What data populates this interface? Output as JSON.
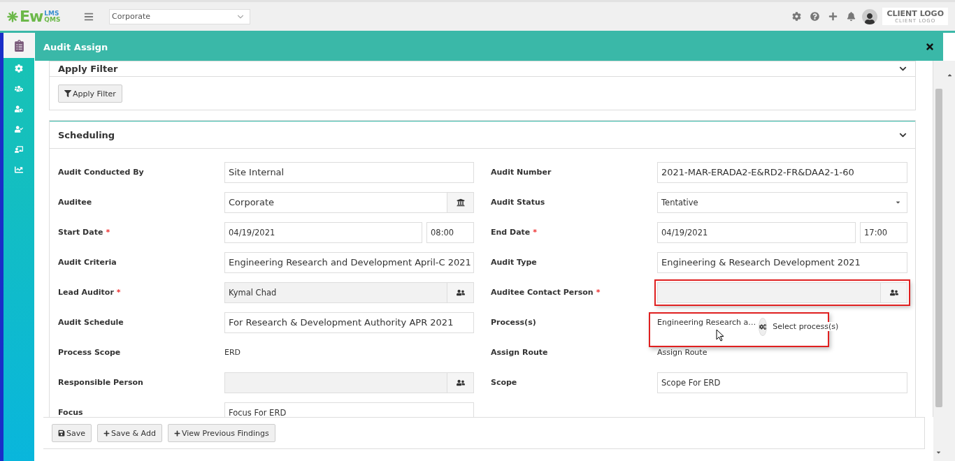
{
  "header": {
    "logo": {
      "name": "Ew",
      "sup": "LMS",
      "sub": "QMS"
    },
    "site_select": {
      "value": "Corporate"
    },
    "client_logo": {
      "title": "CLIENT LOGO",
      "subtitle": "CLIENT LOGO"
    }
  },
  "sidebar": {
    "items": [
      {
        "kind": "document",
        "selected": true
      },
      {
        "kind": "gear",
        "selected": false
      },
      {
        "kind": "users-gear",
        "selected": false
      },
      {
        "kind": "user-shield",
        "selected": false
      },
      {
        "kind": "user-check",
        "selected": false
      },
      {
        "kind": "presenter",
        "selected": false
      },
      {
        "kind": "chart",
        "selected": false
      }
    ]
  },
  "modal": {
    "title": "Audit Assign"
  },
  "filter_section": {
    "title": "Apply Filter",
    "button": "Apply Filter"
  },
  "scheduling": {
    "title": "Scheduling",
    "rows": [
      {
        "left": {
          "label": "Audit Conducted By",
          "kind": "text",
          "value": "Site Internal"
        },
        "right": {
          "label": "Audit Number",
          "kind": "text",
          "value": "2021-MAR-ERADA2-E&RD2-FR&DAA2-1-60"
        }
      },
      {
        "left": {
          "label": "Auditee",
          "kind": "bank-lookup",
          "readonly": false,
          "value": "Corporate"
        },
        "right": {
          "label": "Audit Status",
          "kind": "select",
          "value": "Tentative"
        }
      },
      {
        "left": {
          "label": "Start Date",
          "required_mark": "*",
          "kind": "datetime",
          "value": "04/19/2021",
          "time": "08:00"
        },
        "right": {
          "label": "End Date",
          "required_mark": "*",
          "kind": "datetime",
          "value": "04/19/2021",
          "time": "17:00"
        }
      },
      {
        "left": {
          "label": "Audit Criteria",
          "kind": "text",
          "value": "Engineering Research and Development April-C 2021"
        },
        "right": {
          "label": "Audit Type",
          "kind": "text",
          "value": "Engineering & Research Development 2021"
        }
      },
      {
        "left": {
          "label": "Lead Auditor",
          "required_mark": "*",
          "kind": "people-lookup",
          "readonly": true,
          "value": "Kymal Chad"
        },
        "right": {
          "label": "Auditee Contact Person",
          "required_mark": "*",
          "kind": "people-lookup",
          "readonly": true,
          "highlighted": true
        }
      },
      {
        "left": {
          "label": "Audit Schedule",
          "kind": "text",
          "value": "For Research & Development Authority APR 2021"
        },
        "right": {
          "label": "Process(s)",
          "kind": "process",
          "value": "Engineering Research a…",
          "button": "Select process(s)",
          "highlighted": true
        }
      },
      {
        "left": {
          "label": "Process Scope",
          "kind": "static",
          "value": "ERD"
        },
        "right": {
          "label": "Assign Route",
          "kind": "static",
          "value": "Assign Route"
        }
      },
      {
        "left": {
          "label": "Responsible Person",
          "kind": "people-lookup",
          "readonly": true
        },
        "right": {
          "label": "Scope",
          "kind": "text",
          "value": "Scope For ERD"
        }
      },
      {
        "left": {
          "label": "Focus",
          "kind": "text",
          "value": "Focus For ERD"
        }
      }
    ]
  },
  "footer_buttons": [
    {
      "kind": "save",
      "label": "Save"
    },
    {
      "kind": "add",
      "label": "Save & Add"
    },
    {
      "kind": "add",
      "label": "View Previous Findings"
    }
  ]
}
